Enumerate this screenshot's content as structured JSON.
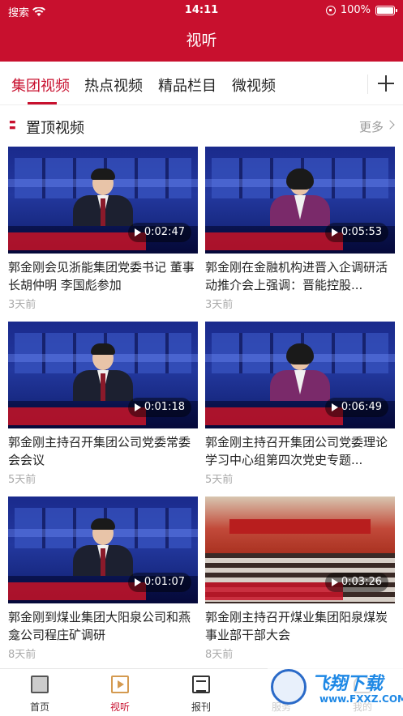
{
  "status_bar": {
    "carrier": "搜索",
    "time": "14:11",
    "battery": "100%"
  },
  "header": {
    "title": "视听"
  },
  "tabs": [
    {
      "label": "集团视频",
      "active": true
    },
    {
      "label": "热点视频",
      "active": false
    },
    {
      "label": "精品栏目",
      "active": false
    },
    {
      "label": "微视频",
      "active": false
    }
  ],
  "section": {
    "title": "置顶视频",
    "more": "更多",
    "icon_text": "置"
  },
  "videos": [
    {
      "title": "郭金刚会见浙能集团党委书记 董事长胡仲明 李国彪参加",
      "duration": "0:02:47",
      "time": "3天前",
      "anchor": "male"
    },
    {
      "title": "郭金刚在金融机构进晋入企调研活动推介会上强调：晋能控股...",
      "duration": "0:05:53",
      "time": "3天前",
      "anchor": "female"
    },
    {
      "title": "郭金刚主持召开集团公司党委常委会会议",
      "duration": "0:01:18",
      "time": "5天前",
      "anchor": "male"
    },
    {
      "title": "郭金刚主持召开集团公司党委理论学习中心组第四次党史专题...",
      "duration": "0:06:49",
      "time": "5天前",
      "anchor": "female"
    },
    {
      "title": "郭金刚到煤业集团大阳泉公司和燕龛公司程庄矿调研",
      "duration": "0:01:07",
      "time": "8天前",
      "anchor": "male"
    },
    {
      "title": "郭金刚主持召开煤业集团阳泉煤炭事业部干部大会",
      "duration": "0:03:26",
      "time": "8天前",
      "anchor": "hall"
    }
  ],
  "bottom_nav": [
    {
      "label": "首页",
      "icon": "home-icon",
      "active": false
    },
    {
      "label": "视听",
      "icon": "video-icon",
      "active": true
    },
    {
      "label": "报刊",
      "icon": "newspaper-icon",
      "active": false
    },
    {
      "label": "服务",
      "icon": "service-icon",
      "active": false
    },
    {
      "label": "我的",
      "icon": "user-icon",
      "active": false
    }
  ],
  "watermark": {
    "text": "飞翔下载",
    "url": "www.FXXZ.COM"
  },
  "colors": {
    "brand": "#c8102e",
    "text": "#222222",
    "muted": "#aaaaaa"
  }
}
